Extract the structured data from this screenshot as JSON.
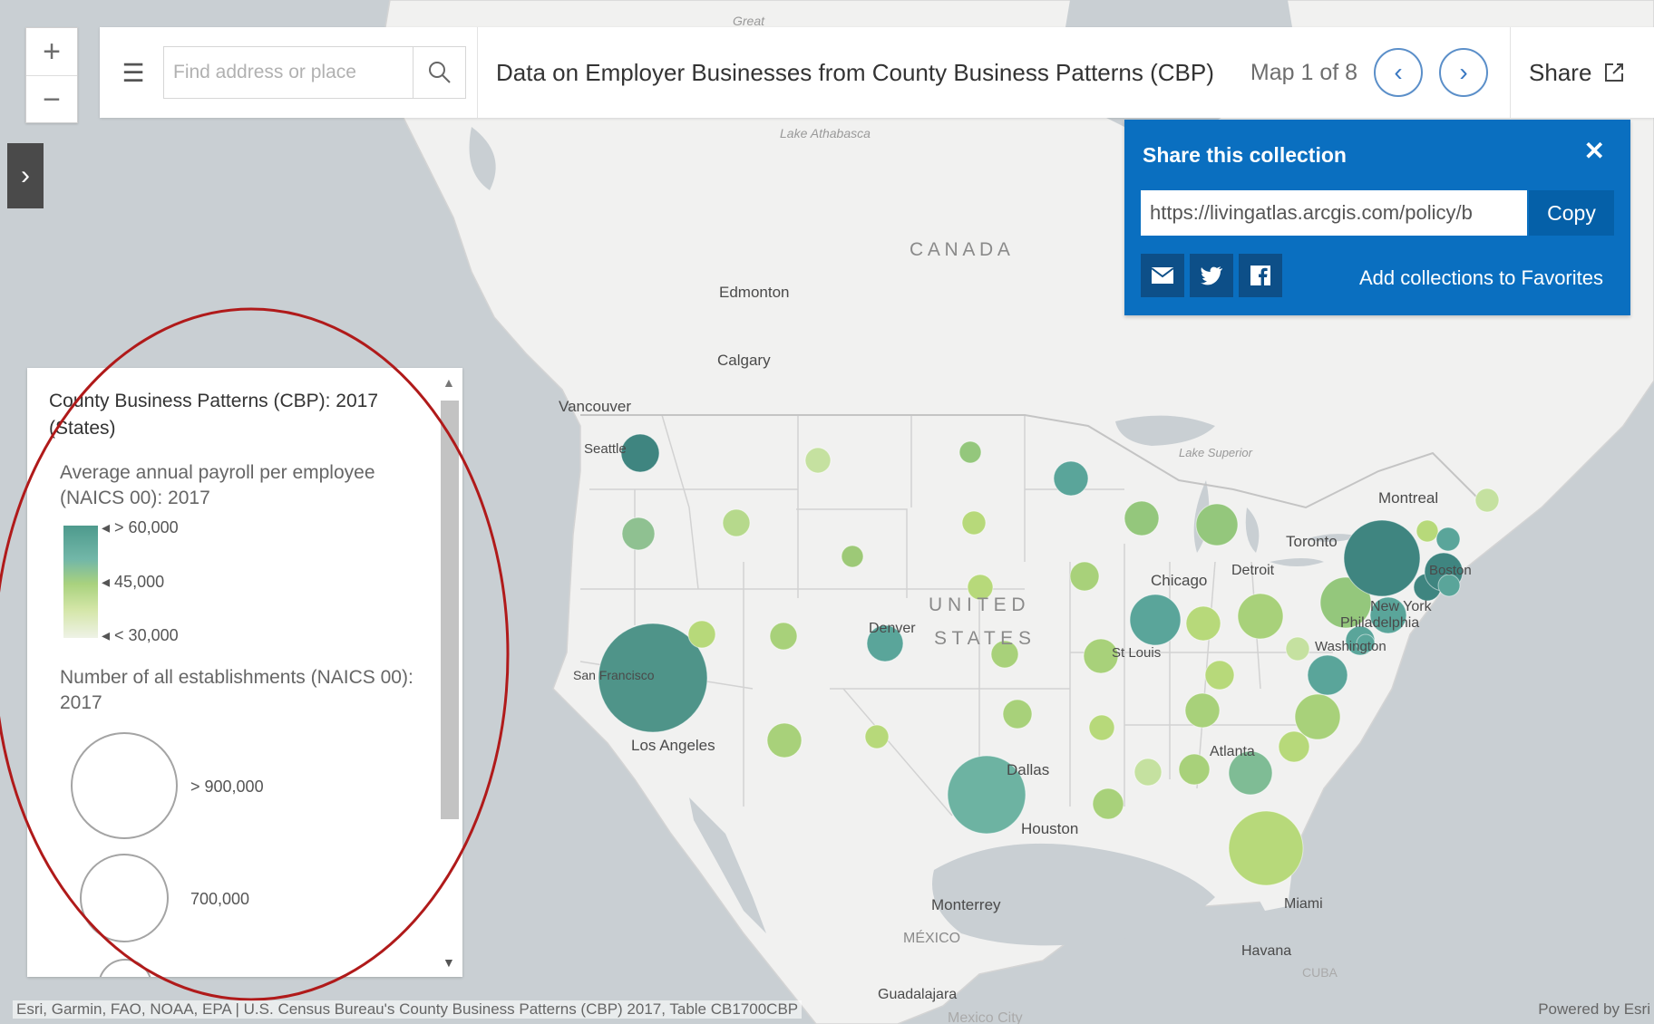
{
  "header": {
    "search_placeholder": "Find address or place",
    "title": "Data on Employer Businesses from County Business Patterns (CBP)",
    "map_counter": "Map 1 of 8",
    "share_label": "Share"
  },
  "share_panel": {
    "title": "Share this collection",
    "url": "https://livingatlas.arcgis.com/policy/b",
    "copy_label": "Copy",
    "favorites_label": "Add collections to Favorites"
  },
  "legend": {
    "title": "County Business Patterns (CBP): 2017 (States)",
    "payroll_label": "Average annual payroll per employee (NAICS 00): 2017",
    "payroll_ticks": [
      "> 60,000",
      "45,000",
      "< 30,000"
    ],
    "establishments_label": "Number of all establishments (NAICS 00): 2017",
    "size_labels": [
      "> 900,000",
      "700,000"
    ]
  },
  "map": {
    "country_labels": {
      "canada": "C A N A D A",
      "us1": "U N I T E D",
      "us2": "S T A T E S",
      "mexico": "MÉXICO",
      "cuba": "CUBA"
    },
    "water_labels": [
      "Great",
      "Lake Athabasca",
      "Lake Superior"
    ],
    "city_labels": [
      "Edmonton",
      "Calgary",
      "Vancouver",
      "Seattle",
      "San Francisco",
      "Los Angeles",
      "Denver",
      "Dallas",
      "Houston",
      "Chicago",
      "Detroit",
      "St Louis",
      "Atlanta",
      "Miami",
      "Havana",
      "Monterrey",
      "Guadalajara",
      "Mexico City",
      "Montreal",
      "Toronto",
      "Boston",
      "New York",
      "Philadelphia",
      "Washington"
    ]
  },
  "attribution": {
    "left": "Esri, Garmin, FAO, NOAA, EPA | U.S. Census Bureau's County Business Patterns (CBP) 2017, Table CB1700CBP",
    "right": "Powered by Esri"
  },
  "colors": {
    "accent_blue": "#0a6fc0",
    "teal": "#4e9a8d",
    "light_green": "#b9d98a"
  }
}
